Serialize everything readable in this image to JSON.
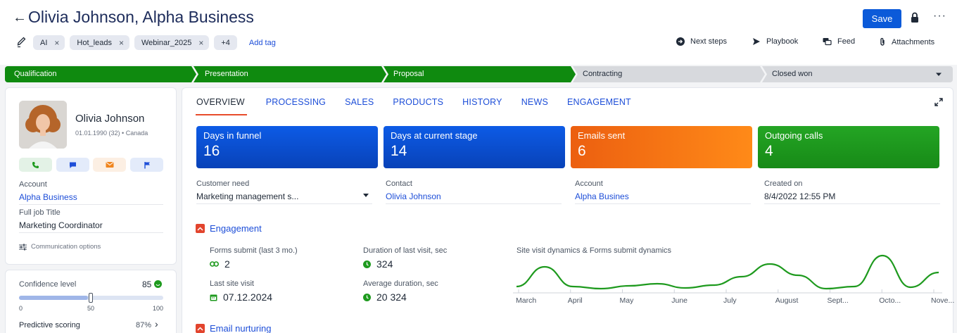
{
  "header": {
    "title": "Olivia Johnson, Alpha Business",
    "back_icon": "arrow-left-icon",
    "save_label": "Save",
    "tags": [
      "AI",
      "Hot_leads",
      "Webinar_2025"
    ],
    "more_tags": "+4",
    "add_tag": "Add tag",
    "actions": [
      {
        "label": "Next steps",
        "icon": "arrow-circle-icon"
      },
      {
        "label": "Playbook",
        "icon": "send-icon"
      },
      {
        "label": "Feed",
        "icon": "chat-icon"
      },
      {
        "label": "Attachments",
        "icon": "paperclip-icon"
      }
    ]
  },
  "pipeline": {
    "stages": [
      {
        "label": "Qualification",
        "state": "done"
      },
      {
        "label": "Presentation",
        "state": "done"
      },
      {
        "label": "Proposal",
        "state": "done"
      },
      {
        "label": "Contracting",
        "state": "todo"
      },
      {
        "label": "Closed won",
        "state": "todo"
      }
    ],
    "colors": {
      "done": "#0f8a0f",
      "todo": "#d7d9dd"
    }
  },
  "profile": {
    "name": "Olivia Johnson",
    "meta": "01.01.1990 (32) • Canada",
    "account_label": "Account",
    "account_value": "Alpha Business",
    "job_label": "Full job Title",
    "job_value": "Marketing Coordinator",
    "comm_options": "Communication options"
  },
  "confidence": {
    "label": "Confidence level",
    "value": "85",
    "level": 0.85,
    "scale": [
      "0",
      "50",
      "100"
    ],
    "predictive_label": "Predictive scoring",
    "predictive_value": "87%"
  },
  "tabs": [
    "OVERVIEW",
    "PROCESSING",
    "SALES",
    "PRODUCTS",
    "HISTORY",
    "NEWS",
    "ENGAGEMENT"
  ],
  "kpis": [
    {
      "label": "Days in funnel",
      "value": "16",
      "color": "#0a4fd0"
    },
    {
      "label": "Days at current stage",
      "value": "14",
      "color": "#0a4fd0"
    },
    {
      "label": "Emails sent",
      "value": "6",
      "color": "#f26a12"
    },
    {
      "label": "Outgoing calls",
      "value": "4",
      "color": "#1e9a1e"
    }
  ],
  "fields": {
    "need_label": "Customer need",
    "need_value": "Marketing management s...",
    "contact_label": "Contact",
    "contact_value": "Olivia Johnson",
    "account_label": "Account",
    "account_value": "Alpha Busines",
    "created_label": "Created on",
    "created_value": "8/4/2022 12:55 PM"
  },
  "engagement": {
    "title": "Engagement",
    "forms_label": "Forms submit (last 3 mo.)",
    "forms_value": "2",
    "duration_label": "Duration of last visit, sec",
    "duration_value": "324",
    "last_visit_label": "Last site visit",
    "last_visit_value": "07.12.2024",
    "avg_label": "Average duration, sec",
    "avg_value": "20 324"
  },
  "email_nurturing": {
    "title": "Email nurturing"
  },
  "chart_data": {
    "type": "line",
    "title": "Site visit dynamics & Forms submit dynamics",
    "categories": [
      "March",
      "April",
      "May",
      "June",
      "July",
      "August",
      "Sept...",
      "Octo...",
      "Nove..."
    ],
    "series": [
      {
        "values": [
          0.4,
          3.2,
          0.4,
          0.1,
          0.5,
          0.8,
          0.2,
          0.6,
          1.8,
          3.6,
          2.0,
          0.1,
          0.4,
          4.8,
          0.3,
          2.4
        ],
        "color": "#1e9a1e"
      }
    ],
    "ylim": [
      0,
      5
    ],
    "grid": false
  }
}
